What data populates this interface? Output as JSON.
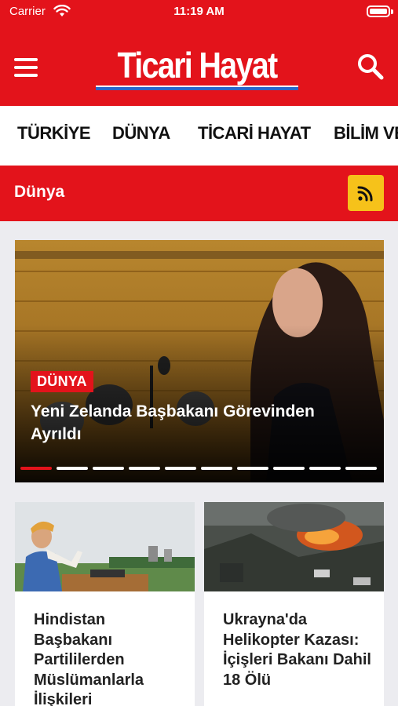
{
  "status_bar": {
    "carrier": "Carrier",
    "time": "11:19 AM"
  },
  "header": {
    "logo": "Ticari Hayat",
    "brand_color": "#e3131b"
  },
  "categories": [
    "TÜRKİYE",
    "DÜNYA",
    "TİCARİ HAYAT",
    "BİLİM VE"
  ],
  "section": {
    "title": "Dünya",
    "rss_color": "#f6c21a"
  },
  "featured": {
    "category": "DÜNYA",
    "title": "Yeni Zelanda Başbakanı Görevinden Ayrıldı",
    "slide_count": 10,
    "active_slide": 1
  },
  "articles": [
    {
      "title": "Hindistan Başbakanı Partililerden Müslümanlarla İlişkileri"
    },
    {
      "title": "Ukrayna'da Helikopter Kazası: İçişleri Bakanı Dahil 18 Ölü"
    }
  ]
}
